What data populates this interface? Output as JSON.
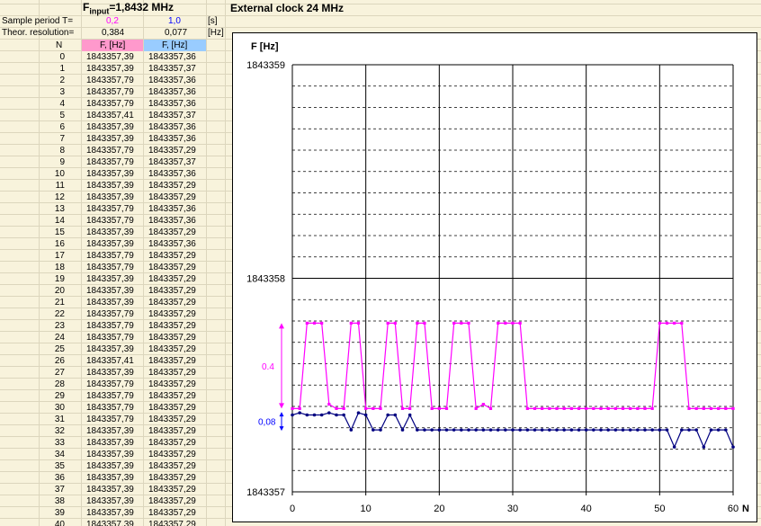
{
  "sheet": {
    "title_prefix": "F",
    "title_sub": "input",
    "title_suffix": "=1,8432 MHz",
    "ext_clock": "External clock 24 MHz",
    "sample_label": "Sample period T=",
    "sample_pink": "0,2",
    "sample_blue": "1,0",
    "sample_unit": "[s]",
    "resolution_label": "Theor. resolution=",
    "resolution_pink": "0,384",
    "resolution_blue": "0,077",
    "resolution_unit": "[Hz]",
    "col_n": "N",
    "col_f1": "F, [Hz]",
    "col_f2": "F, [Hz]"
  },
  "rows": [
    {
      "n": "0",
      "f1": "1843357,39",
      "f2": "1843357,36"
    },
    {
      "n": "1",
      "f1": "1843357,39",
      "f2": "1843357,37"
    },
    {
      "n": "2",
      "f1": "1843357,79",
      "f2": "1843357,36"
    },
    {
      "n": "3",
      "f1": "1843357,79",
      "f2": "1843357,36"
    },
    {
      "n": "4",
      "f1": "1843357,79",
      "f2": "1843357,36"
    },
    {
      "n": "5",
      "f1": "1843357,41",
      "f2": "1843357,37"
    },
    {
      "n": "6",
      "f1": "1843357,39",
      "f2": "1843357,36"
    },
    {
      "n": "7",
      "f1": "1843357,39",
      "f2": "1843357,36"
    },
    {
      "n": "8",
      "f1": "1843357,79",
      "f2": "1843357,29"
    },
    {
      "n": "9",
      "f1": "1843357,79",
      "f2": "1843357,37"
    },
    {
      "n": "10",
      "f1": "1843357,39",
      "f2": "1843357,36"
    },
    {
      "n": "11",
      "f1": "1843357,39",
      "f2": "1843357,29"
    },
    {
      "n": "12",
      "f1": "1843357,39",
      "f2": "1843357,29"
    },
    {
      "n": "13",
      "f1": "1843357,79",
      "f2": "1843357,36"
    },
    {
      "n": "14",
      "f1": "1843357,79",
      "f2": "1843357,36"
    },
    {
      "n": "15",
      "f1": "1843357,39",
      "f2": "1843357,29"
    },
    {
      "n": "16",
      "f1": "1843357,39",
      "f2": "1843357,36"
    },
    {
      "n": "17",
      "f1": "1843357,79",
      "f2": "1843357,29"
    },
    {
      "n": "18",
      "f1": "1843357,79",
      "f2": "1843357,29"
    },
    {
      "n": "19",
      "f1": "1843357,39",
      "f2": "1843357,29"
    },
    {
      "n": "20",
      "f1": "1843357,39",
      "f2": "1843357,29"
    },
    {
      "n": "21",
      "f1": "1843357,39",
      "f2": "1843357,29"
    },
    {
      "n": "22",
      "f1": "1843357,79",
      "f2": "1843357,29"
    },
    {
      "n": "23",
      "f1": "1843357,79",
      "f2": "1843357,29"
    },
    {
      "n": "24",
      "f1": "1843357,79",
      "f2": "1843357,29"
    },
    {
      "n": "25",
      "f1": "1843357,39",
      "f2": "1843357,29"
    },
    {
      "n": "26",
      "f1": "1843357,41",
      "f2": "1843357,29"
    },
    {
      "n": "27",
      "f1": "1843357,39",
      "f2": "1843357,29"
    },
    {
      "n": "28",
      "f1": "1843357,79",
      "f2": "1843357,29"
    },
    {
      "n": "29",
      "f1": "1843357,79",
      "f2": "1843357,29"
    },
    {
      "n": "30",
      "f1": "1843357,79",
      "f2": "1843357,29"
    },
    {
      "n": "31",
      "f1": "1843357,79",
      "f2": "1843357,29"
    },
    {
      "n": "32",
      "f1": "1843357,39",
      "f2": "1843357,29"
    },
    {
      "n": "33",
      "f1": "1843357,39",
      "f2": "1843357,29"
    },
    {
      "n": "34",
      "f1": "1843357,39",
      "f2": "1843357,29"
    },
    {
      "n": "35",
      "f1": "1843357,39",
      "f2": "1843357,29"
    },
    {
      "n": "36",
      "f1": "1843357,39",
      "f2": "1843357,29"
    },
    {
      "n": "37",
      "f1": "1843357,39",
      "f2": "1843357,29"
    },
    {
      "n": "38",
      "f1": "1843357,39",
      "f2": "1843357,29"
    },
    {
      "n": "39",
      "f1": "1843357,39",
      "f2": "1843357,29"
    },
    {
      "n": "40",
      "f1": "1843357,39",
      "f2": "1843357,29"
    }
  ],
  "colors": {
    "pink": "#ff00ff",
    "navy": "#000080",
    "blue": "#0000ff",
    "pink_header": "#ff99cc",
    "blue_header": "#99ccff"
  },
  "chart_data": {
    "type": "line",
    "ylabel": "F [Hz]",
    "xlabel": "N",
    "xlim": [
      0,
      60
    ],
    "ylim": [
      1843357,
      1843359
    ],
    "x_ticks": [
      "0",
      "10",
      "20",
      "30",
      "40",
      "50",
      "60"
    ],
    "y_ticks": [
      "1843357",
      "1843358",
      "1843359"
    ],
    "annotations": {
      "pink_span": "0.4",
      "blue_span": "0,08"
    },
    "grid": "major solid, minor dashed",
    "series": [
      {
        "color": "#ff00ff",
        "values": [
          1843357.39,
          1843357.39,
          1843357.79,
          1843357.79,
          1843357.79,
          1843357.41,
          1843357.39,
          1843357.39,
          1843357.79,
          1843357.79,
          1843357.39,
          1843357.39,
          1843357.39,
          1843357.79,
          1843357.79,
          1843357.39,
          1843357.39,
          1843357.79,
          1843357.79,
          1843357.39,
          1843357.39,
          1843357.39,
          1843357.79,
          1843357.79,
          1843357.79,
          1843357.39,
          1843357.41,
          1843357.39,
          1843357.79,
          1843357.79,
          1843357.79,
          1843357.79,
          1843357.39,
          1843357.39,
          1843357.39,
          1843357.39,
          1843357.39,
          1843357.39,
          1843357.39,
          1843357.39,
          1843357.39,
          1843357.39,
          1843357.39,
          1843357.39,
          1843357.39,
          1843357.39,
          1843357.39,
          1843357.39,
          1843357.39,
          1843357.39,
          1843357.79,
          1843357.79,
          1843357.79,
          1843357.79,
          1843357.39,
          1843357.39,
          1843357.39,
          1843357.39,
          1843357.39,
          1843357.39,
          1843357.39
        ]
      },
      {
        "color": "#000080",
        "values": [
          1843357.36,
          1843357.37,
          1843357.36,
          1843357.36,
          1843357.36,
          1843357.37,
          1843357.36,
          1843357.36,
          1843357.29,
          1843357.37,
          1843357.36,
          1843357.29,
          1843357.29,
          1843357.36,
          1843357.36,
          1843357.29,
          1843357.36,
          1843357.29,
          1843357.29,
          1843357.29,
          1843357.29,
          1843357.29,
          1843357.29,
          1843357.29,
          1843357.29,
          1843357.29,
          1843357.29,
          1843357.29,
          1843357.29,
          1843357.29,
          1843357.29,
          1843357.29,
          1843357.29,
          1843357.29,
          1843357.29,
          1843357.29,
          1843357.29,
          1843357.29,
          1843357.29,
          1843357.29,
          1843357.29,
          1843357.29,
          1843357.29,
          1843357.29,
          1843357.29,
          1843357.29,
          1843357.29,
          1843357.29,
          1843357.29,
          1843357.29,
          1843357.29,
          1843357.29,
          1843357.21,
          1843357.29,
          1843357.29,
          1843357.29,
          1843357.21,
          1843357.29,
          1843357.29,
          1843357.29,
          1843357.21
        ]
      }
    ]
  }
}
